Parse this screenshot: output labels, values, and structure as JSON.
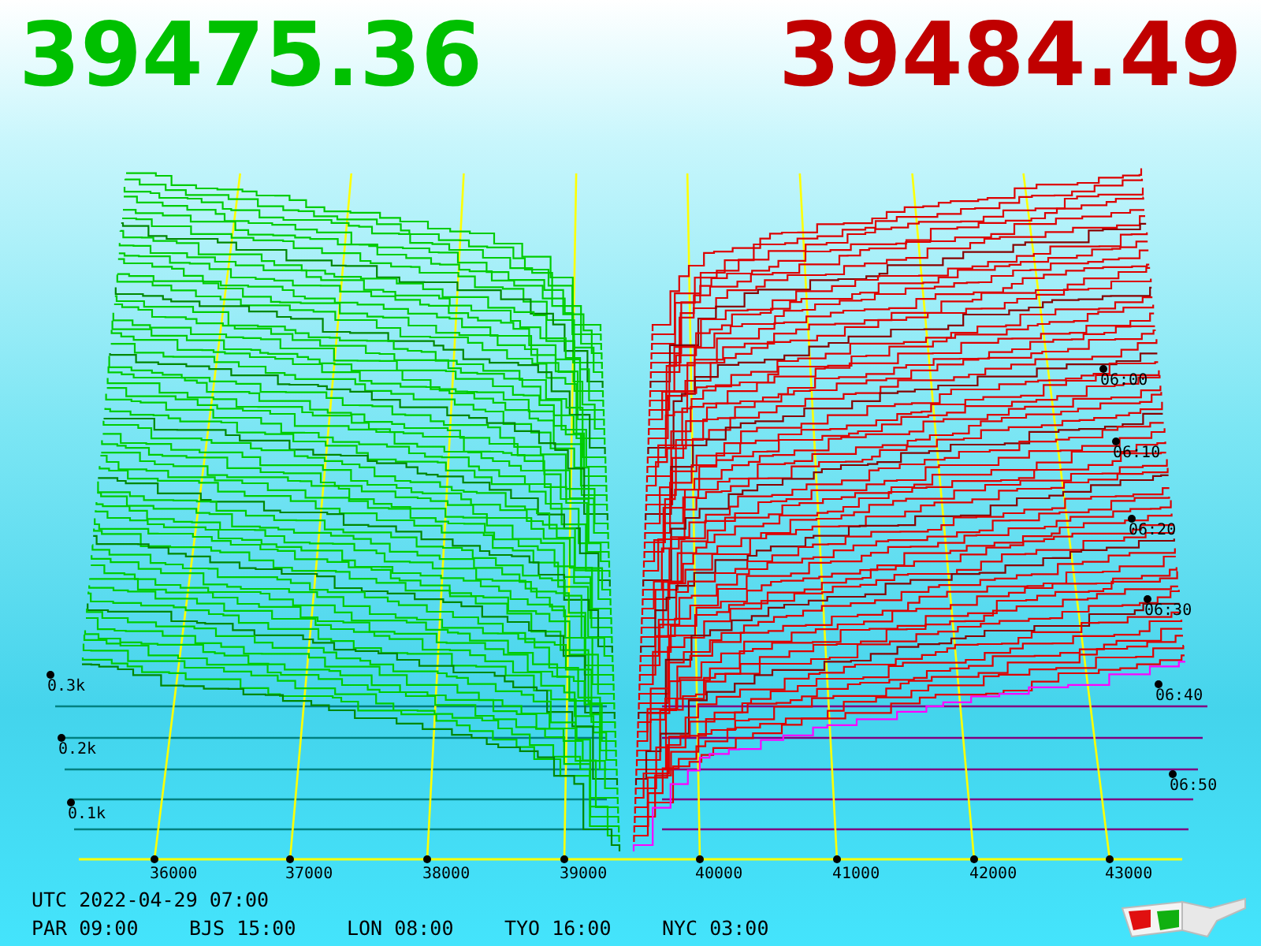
{
  "prices": {
    "bid": "39475.36",
    "ask": "39484.49"
  },
  "chart": {
    "price_ticks": [
      "36000",
      "37000",
      "38000",
      "39000",
      "40000",
      "41000",
      "42000",
      "43000"
    ],
    "depth_ticks": [
      "0.3k",
      "0.2k",
      "0.1k"
    ],
    "time_ticks": [
      "06:00",
      "06:10",
      "06:20",
      "06:30",
      "06:40",
      "06:50"
    ]
  },
  "clock": {
    "utc": "UTC 2022-04-29 07:00",
    "zones": [
      "PAR 09:00",
      "BJS 15:00",
      "LON 08:00",
      "TYO 16:00",
      "NYC 03:00"
    ]
  }
}
